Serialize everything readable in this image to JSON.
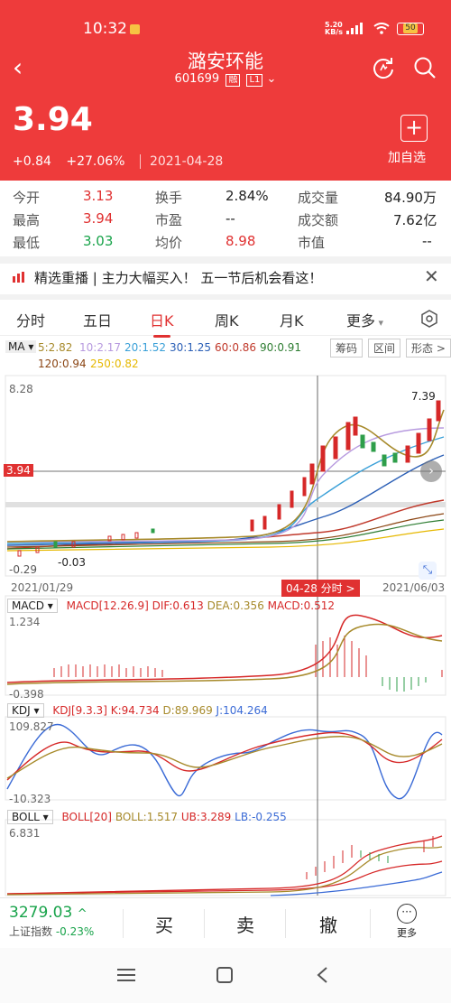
{
  "status": {
    "time": "10:32",
    "net_speed": "5.20\nKB/s",
    "battery": "50"
  },
  "header": {
    "title": "潞安环能",
    "code": "601699",
    "tag1": "融",
    "tag2": "L1",
    "price": "3.94",
    "change": "+0.84",
    "change_pct": "+27.06%",
    "date": "2021-04-28",
    "add_label": "加自选",
    "add_icon": "+"
  },
  "stats": [
    {
      "label": "今开",
      "value": "3.13",
      "color": "red"
    },
    {
      "label": "最高",
      "value": "3.94",
      "color": "red"
    },
    {
      "label": "最低",
      "value": "3.03",
      "color": "green"
    },
    {
      "label": "换手",
      "value": "2.84%",
      "color": "black"
    },
    {
      "label": "市盈",
      "value": "--",
      "color": "black"
    },
    {
      "label": "均价",
      "value": "8.98",
      "color": "red"
    },
    {
      "label": "成交量",
      "value": "84.90万",
      "color": "black"
    },
    {
      "label": "成交额",
      "value": "7.62亿",
      "color": "black"
    },
    {
      "label": "市值",
      "value": "--",
      "color": "black"
    }
  ],
  "news": {
    "text": "精选重播 | 主力大幅买入！ 五一节后机会看这！",
    "close": "✕"
  },
  "tabs": [
    "分时",
    "五日",
    "日K",
    "周K",
    "月K",
    "更多"
  ],
  "ma": {
    "selector": "MA",
    "values": [
      "5:2.82",
      "10:2.17",
      "20:1.52",
      "30:1.25",
      "60:0.86",
      "90:0.91",
      "120:0.94",
      "250:0.82"
    ],
    "tools": [
      "筹码",
      "区间",
      "形态 >"
    ]
  },
  "kline": {
    "high": "8.28",
    "cross_price": "3.94",
    "peak": "7.39",
    "low": "-0.03",
    "low2": "-0.29",
    "date_start": "2021/01/29",
    "date_end": "2021/06/03",
    "cross_date": "04-28 分时 >"
  },
  "macd": {
    "name": "MACD",
    "params": "MACD[12.26.9]",
    "dif": "DIF:0.613",
    "dea": "DEA:0.356",
    "macd": "MACD:0.512",
    "top": "1.234",
    "bottom": "-0.398"
  },
  "kdj": {
    "name": "KDJ",
    "params": "KDJ[9.3.3]",
    "k": "K:94.734",
    "d": "D:89.969",
    "j": "J:104.264",
    "top": "109.827",
    "bottom": "-10.323"
  },
  "boll": {
    "name": "BOLL",
    "params": "BOLL[20]",
    "boll": "BOLL:1.517",
    "ub": "UB:3.289",
    "lb": "LB:-0.255",
    "top": "6.831"
  },
  "bottom": {
    "index_value": "3279.03",
    "index_name": "上证指数",
    "index_chg": "-0.23%",
    "buy": "买",
    "sell": "卖",
    "cancel": "撤",
    "more": "更多"
  }
}
